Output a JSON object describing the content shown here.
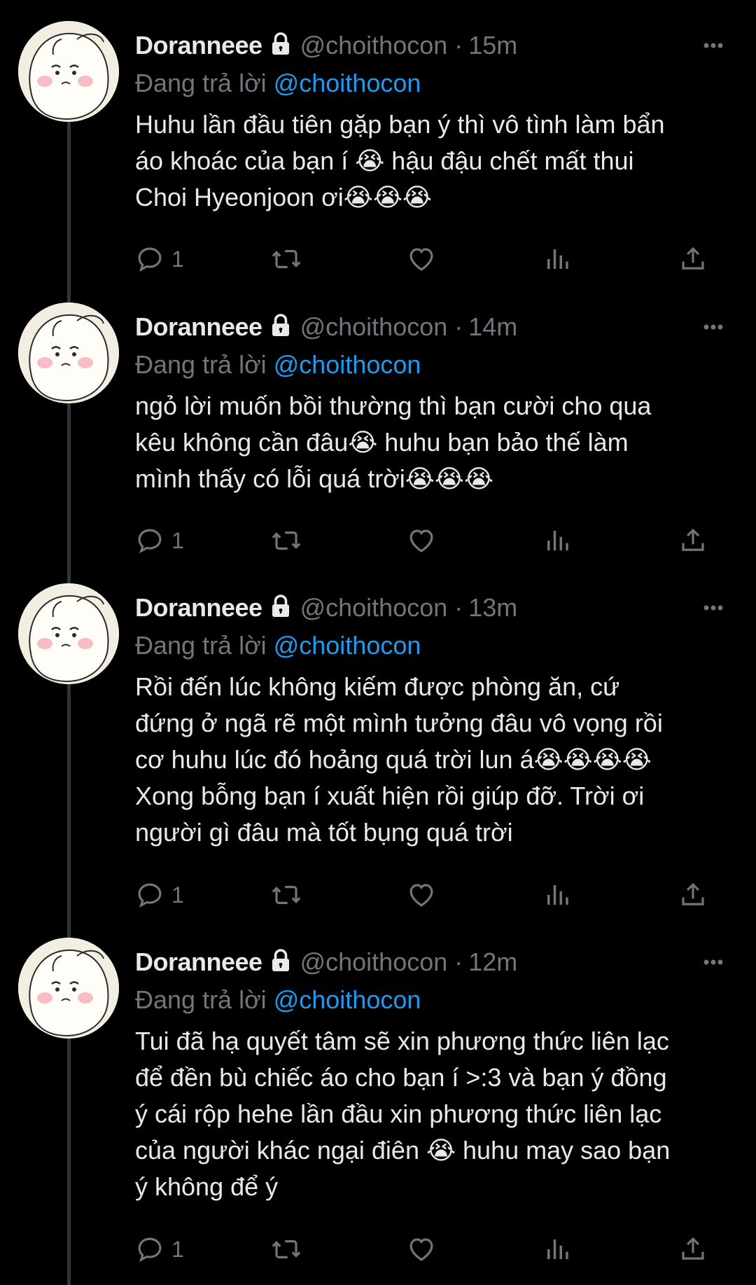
{
  "colors": {
    "background": "#000000",
    "text": "#e7e9ea",
    "muted": "#71767b",
    "link": "#1d9bf0"
  },
  "tweets": [
    {
      "name": "Doranneee",
      "handle": "@choithocon",
      "separator": "·",
      "time": "15m",
      "reply_prefix": "Đang trả lời",
      "reply_to": "@choithocon",
      "text": "Huhu lần đầu tiên gặp bạn ý thì vô tình làm bẩn\náo khoác của bạn í 😭 hậu đậu chết mất thui\nChoi Hyeonjoon ơi😭😭😭",
      "reply_count": "1"
    },
    {
      "name": "Doranneee",
      "handle": "@choithocon",
      "separator": "·",
      "time": "14m",
      "reply_prefix": "Đang trả lời",
      "reply_to": "@choithocon",
      "text": "ngỏ lời muốn bồi thường thì bạn cười cho qua\nkêu không cần đâu😭 huhu bạn bảo thế làm\nmình thấy có lỗi quá trời😭😭😭",
      "reply_count": "1"
    },
    {
      "name": "Doranneee",
      "handle": "@choithocon",
      "separator": "·",
      "time": "13m",
      "reply_prefix": "Đang trả lời",
      "reply_to": "@choithocon",
      "text": "Rồi đến lúc không kiếm được phòng ăn, cứ\nđứng ở ngã rẽ một mình tưởng đâu vô vọng rồi\ncơ huhu lúc đó hoảng quá trời lun á😭😭😭😭\nXong bỗng bạn í xuất hiện rồi giúp đỡ. Trời ơi\nngười gì đâu mà tốt bụng quá trời",
      "reply_count": "1"
    },
    {
      "name": "Doranneee",
      "handle": "@choithocon",
      "separator": "·",
      "time": "12m",
      "reply_prefix": "Đang trả lời",
      "reply_to": "@choithocon",
      "text": "Tui đã hạ quyết tâm sẽ xin phương thức liên lạc\nđể đền bù chiếc áo cho bạn í >:3 và bạn ý đồng\ný cái rộp hehe lần đầu xin phương thức liên lạc\ncủa người khác ngại điên 😭 huhu may sao bạn\ný không để ý",
      "reply_count": "1"
    }
  ],
  "icons": {
    "lock": "lock-icon",
    "more": "more-icon",
    "reply": "reply-icon",
    "retweet": "retweet-icon",
    "like": "like-icon",
    "views": "views-icon",
    "share": "share-icon"
  }
}
